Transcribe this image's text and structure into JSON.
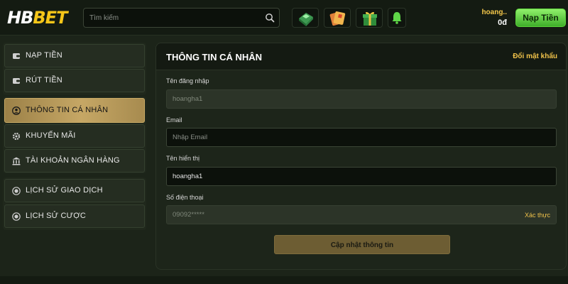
{
  "header": {
    "logo_hb": "HB",
    "logo_bet": "BET",
    "search_placeholder": "Tìm kiếm",
    "icons": [
      "gem-box-icon",
      "gift-card-icon",
      "gift-box-icon",
      "bell-icon"
    ],
    "username": "hoang..",
    "balance": "0đ",
    "deposit_label": "Nạp Tiền"
  },
  "sidebar": {
    "items": [
      {
        "label": "NẠP TIỀN",
        "icon": "wallet-icon"
      },
      {
        "label": "RÚT TIỀN",
        "icon": "wallet-icon"
      },
      {
        "label": "THÔNG TIN CÁ NHÂN",
        "icon": "user-icon",
        "active": true
      },
      {
        "label": "KHUYẾN MÃI",
        "icon": "gear-icon"
      },
      {
        "label": "TÀI KHOẢN NGÂN HÀNG",
        "icon": "bank-icon"
      },
      {
        "label": "LỊCH SỬ GIAO DỊCH",
        "icon": "coin-history-icon"
      },
      {
        "label": "LỊCH SỬ CƯỢC",
        "icon": "coin-history-icon"
      }
    ]
  },
  "main": {
    "title": "THÔNG TIN CÁ NHÂN",
    "change_password": "Đổi mật khẩu",
    "fields": {
      "username_label": "Tên đăng nhập",
      "username_value": "hoangha1",
      "email_label": "Email",
      "email_placeholder": "Nhập Email",
      "display_label": "Tên hiển thị",
      "display_value": "hoangha1",
      "phone_label": "Số điện thoại",
      "phone_value": "09092*****",
      "verify_label": "Xác thực"
    },
    "submit_label": "Cập nhật thông tin"
  },
  "colors": {
    "accent_gold": "#f0c24a",
    "deposit_green": "#5bd23a",
    "active_item": "#c6a765",
    "background": "#1c2419"
  }
}
